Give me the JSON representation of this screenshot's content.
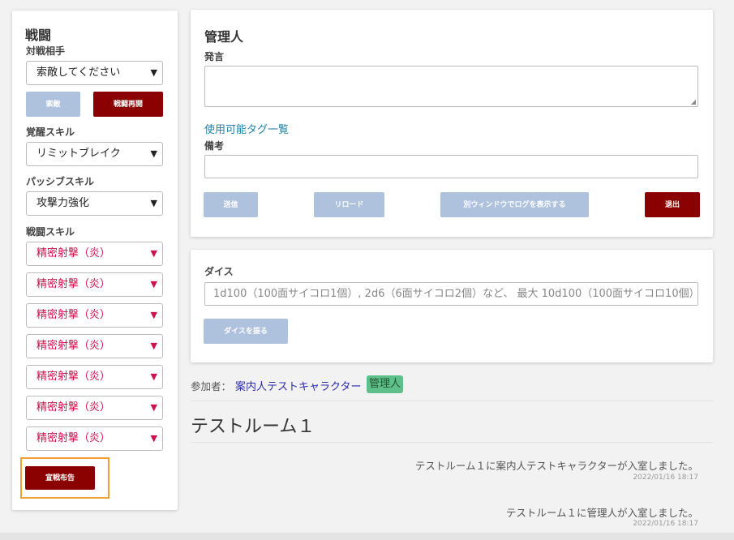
{
  "battle": {
    "title": "戦闘",
    "opponent_label": "対戦相手",
    "opponent_select": "索敵してください",
    "search_button": "索敵",
    "resume_button": "戦闘再開",
    "awaken_label": "覚醒スキル",
    "awaken_select": "リミットブレイク",
    "passive_label": "パッシブスキル",
    "passive_select": "攻撃力強化",
    "combat_label": "戦闘スキル",
    "combat_skills": [
      "精密射撃（炎）",
      "精密射撃（炎）",
      "精密射撃（炎）",
      "精密射撃（炎）",
      "精密射撃（炎）",
      "精密射撃（炎）",
      "精密射撃（炎）"
    ],
    "declare_button": "宣戦布告"
  },
  "admin": {
    "title": "管理人",
    "speech_label": "発言",
    "tags_link": "使用可能タグ一覧",
    "note_label": "備考",
    "send_button": "送信",
    "reload_button": "リロード",
    "log_button": "別ウィンドウでログを表示する",
    "exit_button": "退出"
  },
  "dice": {
    "label": "ダイス",
    "placeholder": "1d100（100面サイコロ1個）, 2d6（6面サイコロ2個）など、 最大 10d100（100面サイコロ10個）",
    "roll_button": "ダイスを振る"
  },
  "participants": {
    "label": "参加者：",
    "name": "案内人テストキャラクター",
    "admin_badge": "管理人"
  },
  "room": {
    "title": "テストルーム１",
    "messages": [
      {
        "text": "テストルーム１に案内人テストキャラクターが入室しました。",
        "time": "2022/01/16 18:17"
      },
      {
        "text": "テストルーム１に管理人が入室しました。",
        "time": "2022/01/16 18:17"
      }
    ]
  },
  "colors": {
    "accent_red": "#8b0000",
    "button_blue": "#aec1dd",
    "skill_text": "#d0104c",
    "highlight": "#f0a030"
  }
}
